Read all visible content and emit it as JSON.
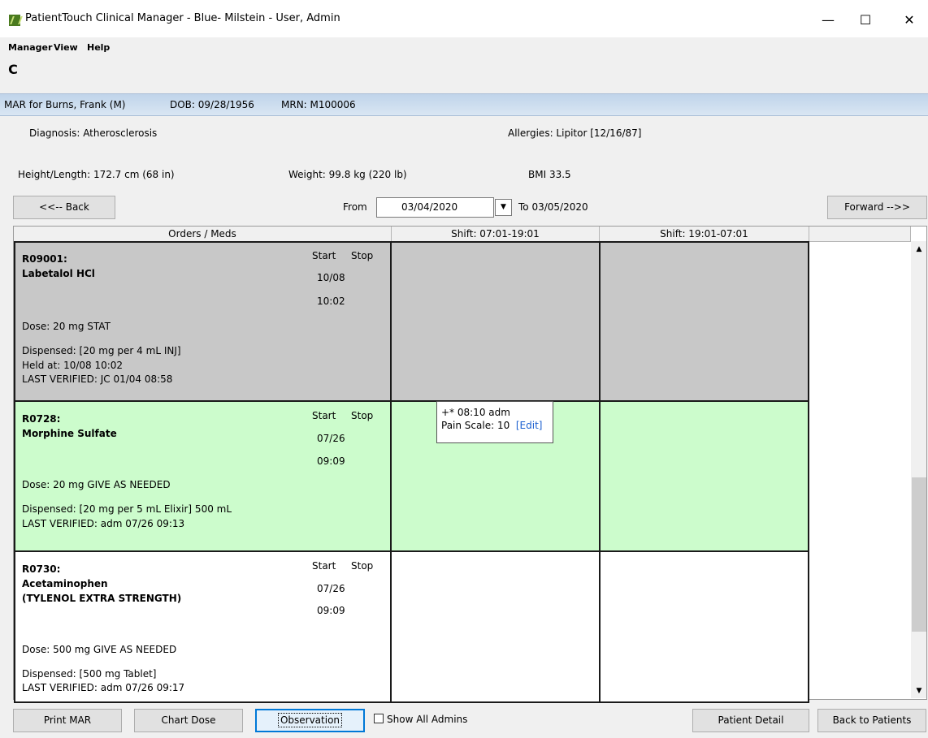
{
  "window": {
    "title": "PatientTouch Clinical Manager - Blue- Milstein - User, Admin",
    "minimize": "—",
    "maximize": "☐",
    "close": "✕"
  },
  "menu": {
    "manager": "Manager",
    "view": "View",
    "help": "Help"
  },
  "toolbar": {
    "refresh_glyph": "C"
  },
  "patient": {
    "mar_for": "MAR for Burns, Frank  (M)",
    "dob": "DOB: 09/28/1956",
    "mrn": "MRN: M100006",
    "diagnosis": "Diagnosis: Atherosclerosis",
    "allergies": "Allergies: Lipitor [12/16/87]",
    "height": "Height/Length: 172.7 cm (68 in)",
    "weight": "Weight: 99.8 kg (220 lb)",
    "bmi": "BMI  33.5"
  },
  "nav": {
    "back": "<<-- Back",
    "from_label": "From",
    "from_date": "03/04/2020",
    "to_label": "To 03/05/2020",
    "forward": "Forward -->>",
    "dropdown_glyph": "▼"
  },
  "grid": {
    "headers": [
      "Orders / Meds",
      "Shift: 07:01-19:01",
      "Shift: 19:01-07:01"
    ],
    "orders": [
      {
        "id": "R09001:",
        "name": "Labetalol HCl",
        "name2": "",
        "start_label": "Start",
        "stop_label": "Stop",
        "date": "10/08",
        "time": "10:02",
        "dose": "Dose: 20 mg STAT",
        "dispensed": "Dispensed: [20 mg per 4 mL INJ]",
        "held": "Held at: 10/08 10:02",
        "verified": "LAST VERIFIED: JC 01/04 08:58",
        "bg": "#c8c8c8"
      },
      {
        "id": "R0728:",
        "name": "Morphine Sulfate",
        "name2": "",
        "start_label": "Start",
        "stop_label": "Stop",
        "date": "07/26",
        "time": "09:09",
        "dose": "Dose: 20 mg GIVE AS NEEDED",
        "dispensed": "Dispensed: [20 mg per 5 mL Elixir] 500 mL",
        "verified": "LAST VERIFIED: adm 07/26 09:13",
        "bg": "#ccfccc",
        "admin": {
          "line1": "+* 08:10 adm",
          "line2": "Pain Scale: 10",
          "edit": "[Edit]"
        }
      },
      {
        "id": "R0730:",
        "name": "Acetaminophen",
        "name2": "(TYLENOL EXTRA STRENGTH)",
        "start_label": "Start",
        "stop_label": "Stop",
        "date": "07/26",
        "time": "09:09",
        "dose": "Dose: 500 mg GIVE AS NEEDED",
        "dispensed": "Dispensed: [500 mg Tablet]",
        "verified": "LAST VERIFIED: adm 07/26 09:17",
        "bg": "#ffffff"
      }
    ]
  },
  "scroll": {
    "up": "▲",
    "down": "▼"
  },
  "bottom": {
    "print_mar": "Print MAR",
    "chart_dose": "Chart Dose",
    "observation": "Observation",
    "show_all": "Show All Admins",
    "patient_detail": "Patient Detail",
    "back_to_patients": "Back to Patients"
  }
}
